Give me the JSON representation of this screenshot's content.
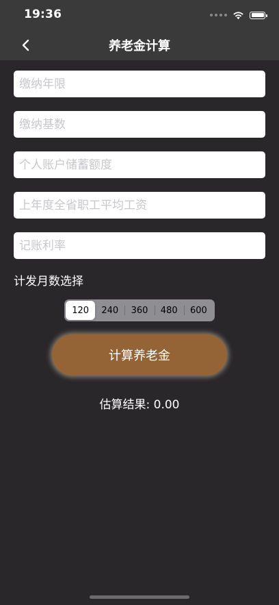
{
  "status_bar": {
    "time": "19:36",
    "icons": [
      "signal-dots-icon",
      "wifi-icon",
      "battery-icon"
    ]
  },
  "nav": {
    "title": "养老金计算",
    "back_icon": "chevron-left-icon"
  },
  "form": {
    "payment_years_placeholder": "缴纳年限",
    "payment_base_placeholder": "缴纳基数",
    "personal_account_placeholder": "个人账户储蓄额度",
    "avg_salary_placeholder": "上年度全省职工平均工资",
    "interest_rate_placeholder": "记账利率"
  },
  "months": {
    "label": "计发月数选择",
    "options": [
      "120",
      "240",
      "360",
      "480",
      "600"
    ],
    "selected": "120"
  },
  "actions": {
    "calculate_label": "计算养老金"
  },
  "result": {
    "text": "估算结果: 0.00"
  },
  "colors": {
    "background": "#29272a",
    "nav_bar": "#3a3a3a",
    "accent_button": "#956436",
    "segment_bg": "#8e8e93"
  }
}
